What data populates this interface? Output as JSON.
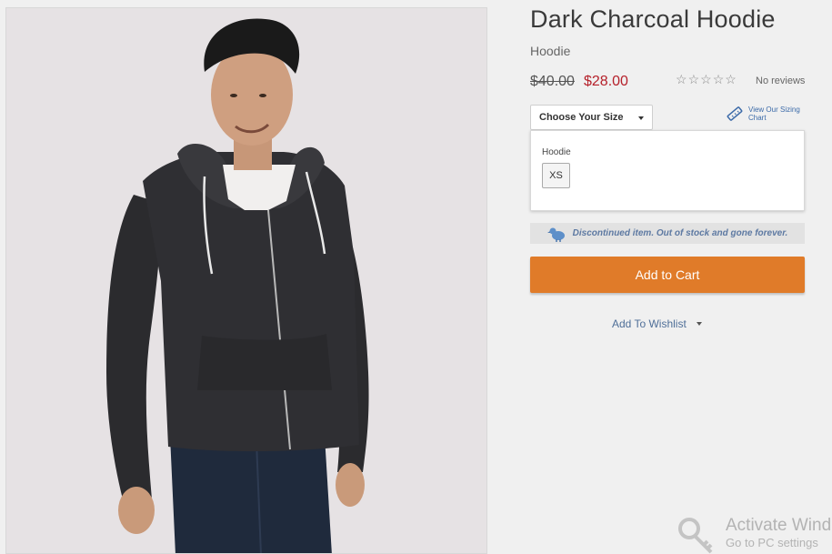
{
  "product": {
    "title": "Dark Charcoal Hoodie",
    "category": "Hoodie",
    "old_price": "$40.00",
    "new_price": "$28.00",
    "rating_stars": 0,
    "reviews_label": "No reviews",
    "image_icon": "model-photo"
  },
  "size": {
    "select_label": "Choose Your Size",
    "chart_link": "View Our Sizing Chart",
    "panel_label": "Hoodie",
    "options": [
      "XS"
    ]
  },
  "notice": {
    "text": "Discontinued item. Out of stock and gone forever.",
    "icon": "dodo-bird-icon"
  },
  "actions": {
    "add_to_cart": "Add to Cart",
    "add_to_wishlist": "Add To Wishlist"
  },
  "watermark": {
    "line1": "Activate Wind",
    "line2": "Go to PC settings"
  },
  "colors": {
    "accent": "#e07b29",
    "sale": "#b5202a",
    "link": "#4f6f98"
  }
}
